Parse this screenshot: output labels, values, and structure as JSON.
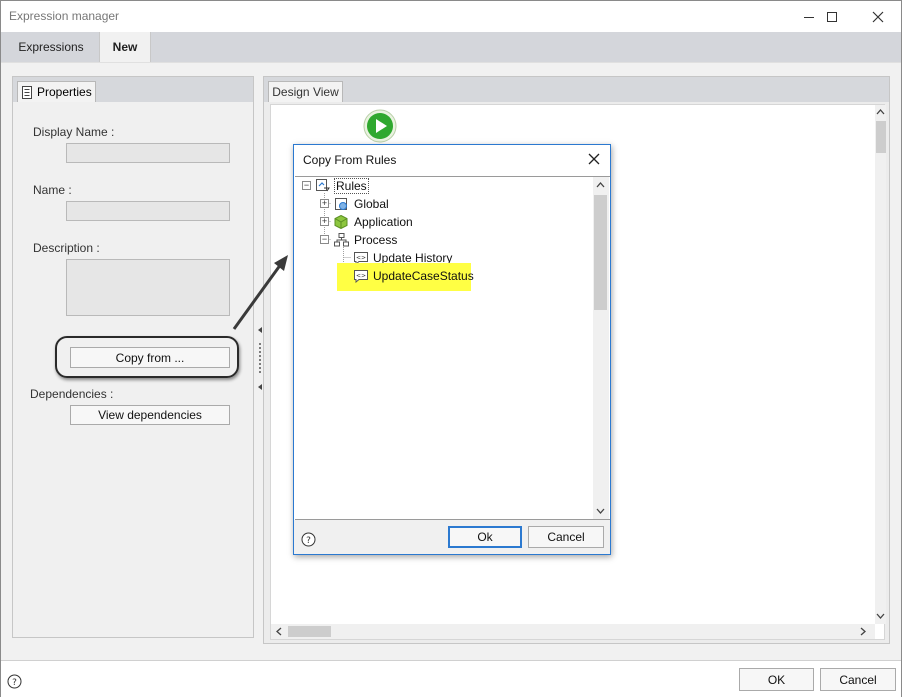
{
  "window": {
    "title": "Expression manager"
  },
  "tabs": [
    {
      "label": "Expressions"
    },
    {
      "label": "New"
    }
  ],
  "properties": {
    "tab_label": "Properties",
    "display_name": {
      "label": "Display Name :",
      "value": ""
    },
    "name": {
      "label": "Name :",
      "value": ""
    },
    "description": {
      "label": "Description :",
      "value": ""
    },
    "copy_from_label": "Copy from ...",
    "dependencies_label": "Dependencies :",
    "view_dependencies_label": "View dependencies"
  },
  "design_view": {
    "tab_label": "Design View"
  },
  "dialog": {
    "title": "Copy From Rules",
    "tree": {
      "root": "Rules",
      "items": [
        "Global",
        "Application",
        "Process"
      ],
      "process_children": [
        "Update History",
        "UpdateCaseStatus"
      ]
    },
    "ok_label": "Ok",
    "cancel_label": "Cancel"
  },
  "footer": {
    "ok_label": "OK",
    "cancel_label": "Cancel"
  },
  "colors": {
    "highlight": "#ffff44",
    "accent": "#2b79d0",
    "start_green": "#2fa82f"
  }
}
